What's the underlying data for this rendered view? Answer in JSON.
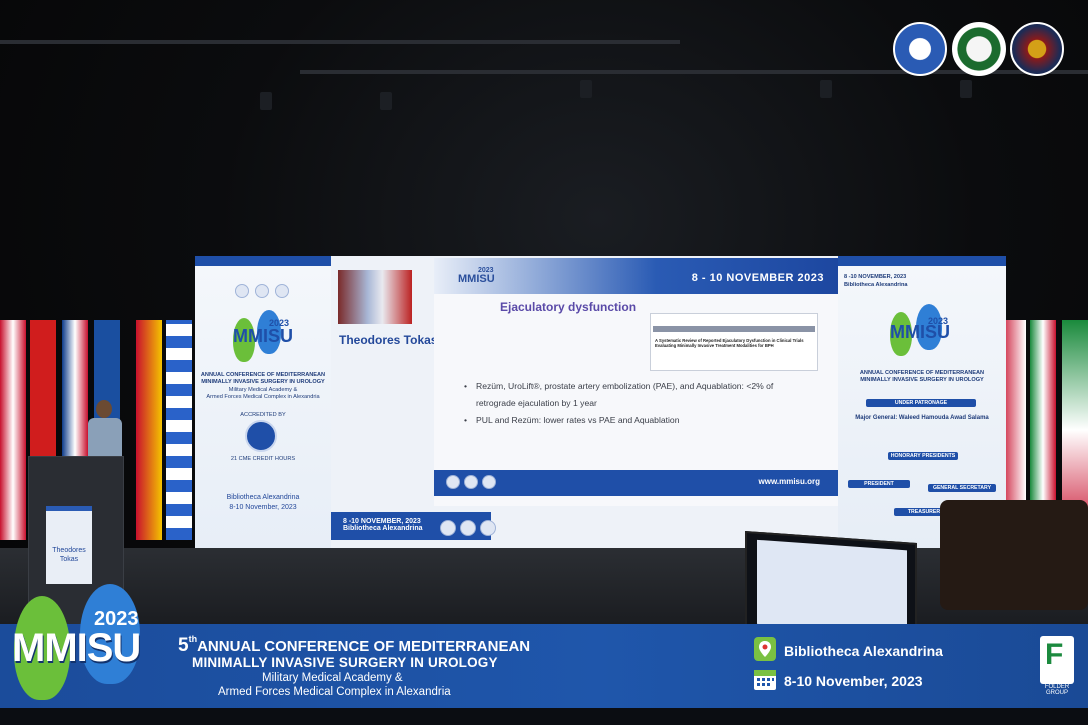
{
  "speaker": {
    "name": "Theodores Tokas",
    "podium_name": "Theodores Tokas"
  },
  "slide": {
    "date": "8 - 10 NOVEMBER 2023",
    "logo": "MMISU",
    "logo_year": "2023",
    "title": "Ejaculatory dysfunction",
    "paper_title": "A Systematic Review of Reported Ejaculatory Dysfunction in Clinical Trials Evaluating Minimally Invasive Treatment Modalities for BPH",
    "bullets": [
      "Rezüm, UroLift®, prostate artery embolization (PAE), and Aquablation: <2% of retrograde ejaculation by 1 year",
      "PUL and Rezüm: lower rates vs PAE and Aquablation"
    ],
    "url": "www.mmisu.org"
  },
  "left_panel": {
    "logo": "MMISU",
    "year": "2023",
    "conf_line1": "ANNUAL CONFERENCE OF MEDITERRANEAN",
    "conf_line2": "MINIMALLY INVASIVE SURGERY IN UROLOGY",
    "academy": "Military Medical Academy &",
    "complex": "Armed Forces Medical Complex in Alexandria",
    "accredited": "ACCREDITED BY",
    "cme": "21 CME CREDIT HOURS",
    "venue": "Bibliotheca Alexandrina",
    "dates": "8-10 November, 2023"
  },
  "lower_band": {
    "dates": "8 -10 NOVEMBER, 2023",
    "venue": "Bibliotheca Alexandrina"
  },
  "right_panel": {
    "dates": "8 -10 NOVEMBER, 2023",
    "venue": "Bibliotheca Alexandrina",
    "logo": "MMISU",
    "year": "2023",
    "conf_line1": "ANNUAL CONFERENCE OF MEDITERRANEAN",
    "conf_line2": "MINIMALLY INVASIVE SURGERY IN UROLOGY",
    "patronage": "UNDER PATRONAGE",
    "patron": "Major General: Waleed Hamouda Awad Salama",
    "president": "PRESIDENT",
    "secretary": "GENERAL SECRETARY",
    "treasurer": "TREASURER",
    "honorary": "HONORARY PRESIDENTS"
  },
  "banner": {
    "year": "2023",
    "logo": "MMISU",
    "ordinal": "5",
    "ordinal_suffix": "th",
    "conf_line1": "ANNUAL CONFERENCE OF MEDITERRANEAN",
    "conf_line2": "MINIMALLY INVASIVE SURGERY IN UROLOGY",
    "academy": "Military Medical Academy &",
    "complex": "Armed Forces Medical Complex in Alexandria",
    "venue": "Bibliotheca Alexandrina",
    "dates": "8-10 November, 2023",
    "folder_line1": "FOLDER",
    "folder_line2": "GROUP"
  },
  "colors": {
    "brand_blue": "#1f4fa8",
    "banner_blue": "#1f56ab",
    "kidney_green": "#6bbf3a",
    "kidney_blue": "#2f7fd6"
  }
}
